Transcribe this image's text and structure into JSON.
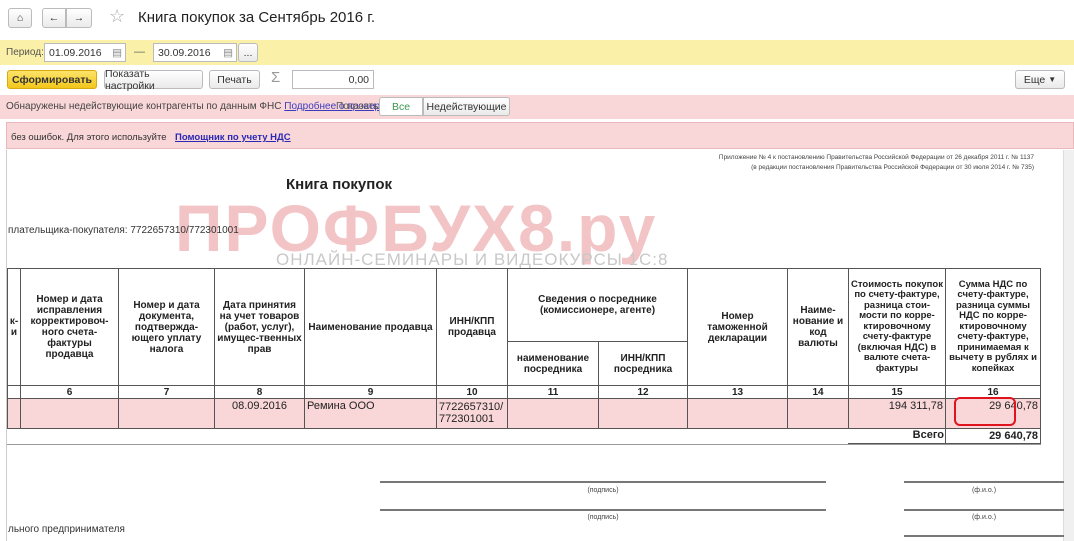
{
  "window": {
    "title": "Книга покупок за Сентябрь 2016 г."
  },
  "period": {
    "label": "Период:",
    "from": "01.09.2016",
    "to": "30.09.2016",
    "dash": "—",
    "more": "..."
  },
  "toolbar": {
    "generate": "Сформировать",
    "settings": "Показать настройки",
    "print": "Печать",
    "sum_icon": "Σ",
    "sum_value": "0,00",
    "more": "Еще"
  },
  "warning": {
    "text": "Обнаружены недействующие контрагенты по данным ФНС",
    "link": "Подробнее о проверке",
    "show_label": "Показать:",
    "filter_all": "Все",
    "filter_inactive": "Недействующие"
  },
  "info": {
    "text": "без ошибок. Для этого используйте",
    "link": "Помощник по учету НДС"
  },
  "report": {
    "appendix1": "Приложение № 4 к постановлению Правительства Российской Федерации от 26 декабря 2011 г. № 1137",
    "appendix2": "(в редакции постановления Правительства Российской Федерации от 30 июля 2014 г. № 735)",
    "title": "Книга покупок",
    "buyer": "плательщика-покупателя:  7722657310/772301001",
    "watermark": "ПРОФБУХ8.ру",
    "watermark_sub": "ОНЛАЙН-СЕМИНАРЫ И ВИДЕОКУРСЫ 1С:8",
    "headers": {
      "c5": "к-\nи",
      "c6": "Номер и дата исправления корректировоч-ного счета-фактуры продавца",
      "c7": "Номер и дата документа, подтвержда-ющего уплату налога",
      "c8": "Дата принятия на учет товаров (работ, услуг), имущес-твенных прав",
      "c9": "Наименование продавца",
      "c10": "ИНН/КПП продавца",
      "c11_12": "Сведения о посреднике (комиссионере, агенте)",
      "c11": "наименование посредника",
      "c12": "ИНН/КПП посредника",
      "c13": "Номер таможенной декларации",
      "c14": "Наиме-нование и код валюты",
      "c15": "Стоимость покупок по счету-фактуре, разница стои-мости по корре-ктировочному счету-фактуре (включая НДС) в валюте счета-фактуры",
      "c16": "Сумма НДС по счету-фактуре, разница суммы НДС по корре-ктировочному счету-фактуре, принимаемая к вычету в рублях и копейках"
    },
    "numbers": [
      "6",
      "7",
      "8",
      "9",
      "10",
      "11",
      "12",
      "13",
      "14",
      "15",
      "16"
    ],
    "row": {
      "date": "08.09.2016",
      "seller": "Ремина ООО",
      "inn": "7722657310/ 772301001",
      "cost": "194 311,78",
      "vat": "29 640,78"
    },
    "total_label": "Всего",
    "total": "29 640,78",
    "sign_label": "(подпись)",
    "fio_label": "(ф.и.о.)",
    "entrepreneur": "льного предпринимателя"
  },
  "colors": {
    "warning_bg": "#f9d6d8",
    "period_bg": "#fbf0a8",
    "highlight": "#e0141e"
  }
}
